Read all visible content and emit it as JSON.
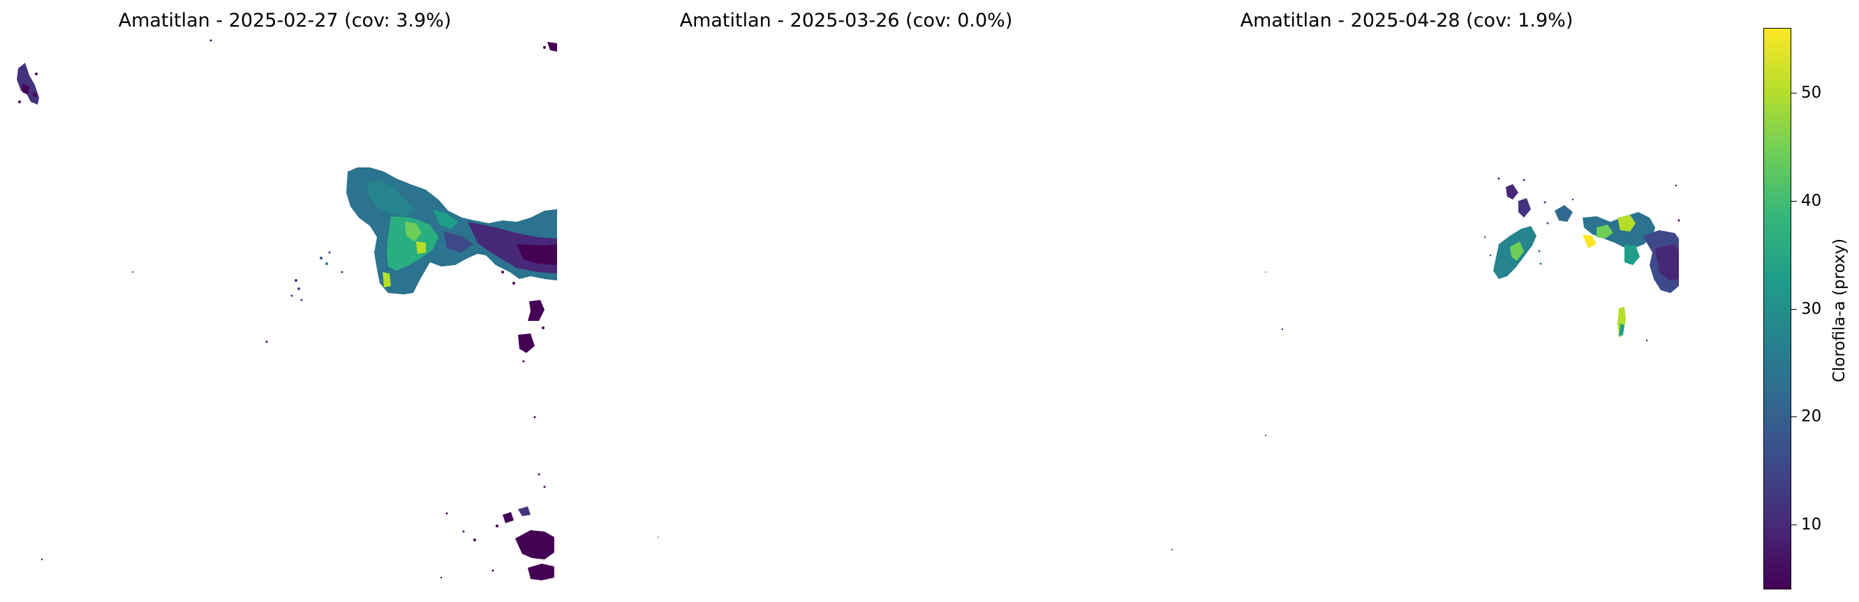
{
  "chart_data": [
    {
      "type": "heatmap",
      "title": "Amatitlan - 2025-02-27  (cov: 3.9%)",
      "date": "2025-02-27",
      "coverage_percent": 3.9,
      "colormap": "viridis",
      "color_range": [
        4,
        56
      ]
    },
    {
      "type": "heatmap",
      "title": "Amatitlan - 2025-03-26  (cov: 0.0%)",
      "date": "2025-03-26",
      "coverage_percent": 0.0,
      "colormap": "viridis",
      "color_range": [
        4,
        56
      ]
    },
    {
      "type": "heatmap",
      "title": "Amatitlan - 2025-04-28  (cov: 1.9%)",
      "date": "2025-04-28",
      "coverage_percent": 1.9,
      "colormap": "viridis",
      "color_range": [
        4,
        56
      ]
    }
  ],
  "colorbar": {
    "label": "Clorofila-a (proxy)",
    "min": 4,
    "max": 56,
    "ticks": [
      10,
      20,
      30,
      40,
      50
    ],
    "colors": [
      "#440154",
      "#482878",
      "#3e4989",
      "#31688e",
      "#26828e",
      "#1f9e89",
      "#35b779",
      "#6ece58",
      "#b5de2b",
      "#fde725"
    ]
  }
}
